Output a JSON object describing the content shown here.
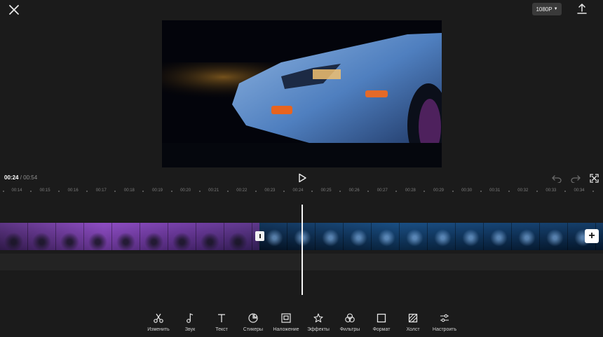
{
  "topbar": {
    "resolution": "1080P"
  },
  "playback": {
    "current": "00:24",
    "separator": " / ",
    "total": "00:54"
  },
  "ruler": {
    "ticks": [
      "00:14",
      "00:15",
      "00:16",
      "00:17",
      "00:18",
      "00:19",
      "00:20",
      "00:21",
      "00:22",
      "00:23",
      "00:24",
      "00:25",
      "00:26",
      "00:27",
      "00:28",
      "00:29",
      "00:30",
      "00:31",
      "00:32",
      "00:33",
      "00:34"
    ]
  },
  "timeline": {
    "add_label": "+"
  },
  "toolbar": {
    "items": [
      {
        "label": "Изменить",
        "icon": "scissors-icon"
      },
      {
        "label": "Звук",
        "icon": "music-note-icon"
      },
      {
        "label": "Текст",
        "icon": "text-icon"
      },
      {
        "label": "Стикеры",
        "icon": "sticker-icon"
      },
      {
        "label": "Наложение",
        "icon": "overlay-icon"
      },
      {
        "label": "Эффекты",
        "icon": "effects-star-icon"
      },
      {
        "label": "Фильтры",
        "icon": "filters-icon"
      },
      {
        "label": "Формат",
        "icon": "format-square-icon"
      },
      {
        "label": "Холст",
        "icon": "canvas-icon"
      },
      {
        "label": "Настроить",
        "icon": "adjust-sliders-icon"
      }
    ]
  }
}
